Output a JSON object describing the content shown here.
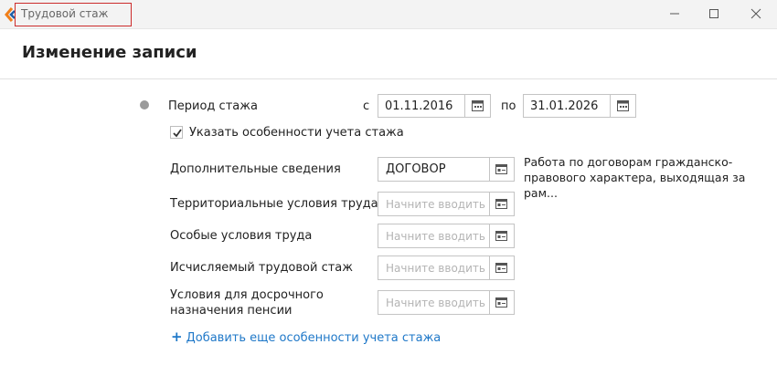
{
  "window": {
    "title": "Трудовой стаж",
    "controls": {
      "minimize_icon": "minimize-icon",
      "maximize_icon": "maximize-icon",
      "close_icon": "close-icon"
    }
  },
  "dialog": {
    "heading": "Изменение записи"
  },
  "period": {
    "label": "Период стажа",
    "from_label": "с",
    "from_value": "01.11.2016",
    "to_label": "по",
    "to_value": "31.01.2026"
  },
  "specifics_checkbox": {
    "label": "Указать особенности учета стажа",
    "checked": true
  },
  "fields": [
    {
      "label": "Дополнительные сведения",
      "value": "ДОГОВОР",
      "placeholder": "",
      "description": "Работа по договорам гражданско-правового характера, выходящая за рам..."
    },
    {
      "label": "Территориальные условия труда",
      "value": "",
      "placeholder": "Начните вводить"
    },
    {
      "label": "Особые условия труда",
      "value": "",
      "placeholder": "Начните вводить"
    },
    {
      "label": "Исчисляемый трудовой стаж",
      "value": "",
      "placeholder": "Начните вводить"
    },
    {
      "label_line1": "Условия для досрочного",
      "label_line2": "назначения пенсии",
      "value": "",
      "placeholder": "Начните вводить"
    }
  ],
  "add_link": {
    "label": "Добавить еще особенности учета стажа"
  },
  "colors": {
    "accent": "#1f78c8",
    "title_highlight": "#cc2b2b",
    "logo_orange": "#f07f1a",
    "logo_blue": "#1f5fa8"
  }
}
